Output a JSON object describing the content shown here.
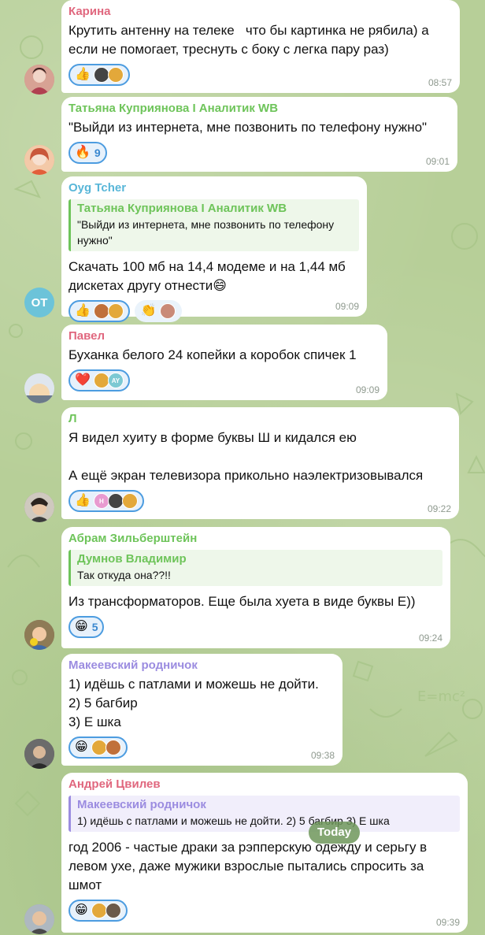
{
  "colors": {
    "accent": "#4c9ce0",
    "karina": "#e0677e",
    "tatiana": "#6ec45a",
    "oyg": "#58b6d8",
    "pavel": "#e0677e",
    "l": "#6ec45a",
    "abram": "#6ec45a",
    "dumnov": "#6ec45a",
    "makeev": "#9b8ce0",
    "andrey": "#e0677e"
  },
  "date_chip": "Today",
  "messages": [
    {
      "sender": "Карина",
      "text": "Крутить антенну на телеке   что бы картинка не рябила) а если не помогает, треснуть с боку с легка пару раз)",
      "time": "08:57",
      "reactions": [
        {
          "emoji": "👍",
          "count": ""
        }
      ]
    },
    {
      "sender": "Татьяна Куприянова I Аналитик WB",
      "text": "\"Выйди из интернета, мне позвонить по телефону нужно\"",
      "time": "09:01",
      "reactions": [
        {
          "emoji": "🔥",
          "count": "9"
        }
      ]
    },
    {
      "sender": "Oyg Tcher",
      "avatar_initials": "OT",
      "quote": {
        "name": "Татьяна Куприянова I Аналитик WB",
        "text": "\"Выйди из интернета, мне позвонить по телефону нужно\""
      },
      "text": "Скачать 100 мб на 14,4 модеме и на 1,44 мб дискетах другу отнести😄",
      "time": "09:09",
      "reactions": [
        {
          "emoji": "👍",
          "count": ""
        },
        {
          "emoji": "👏",
          "count": ""
        }
      ]
    },
    {
      "sender": "Павел",
      "text": "Буханка белого 24 копейки а коробок спичек 1",
      "time": "09:09",
      "reactions": [
        {
          "emoji": "❤️",
          "count": ""
        }
      ],
      "mini_label": "AY"
    },
    {
      "sender": "Л",
      "text": "Я видел хуиту в форме буквы Ш и кидался ею\n\nА ещё экран телевизора прикольно наэлектризовывался",
      "time": "09:22",
      "reactions": [
        {
          "emoji": "👍",
          "count": ""
        }
      ],
      "mini_label": "H"
    },
    {
      "sender": "Абрам Зильберштейн",
      "quote": {
        "name": "Думнов Владимир",
        "text": "Так откуда она??!!"
      },
      "text": "Из трансформаторов. Еще была хуета в виде буквы Е))",
      "time": "09:24",
      "reactions": [
        {
          "emoji": "😁",
          "count": "5"
        }
      ]
    },
    {
      "sender": "Макеевский родничок",
      "text": "1) идёшь с патлами и можешь не дойти.\n2) 5 багбир\n3) Е шка",
      "time": "09:38",
      "reactions": [
        {
          "emoji": "😁",
          "count": ""
        }
      ]
    },
    {
      "sender": "Андрей Цвилев",
      "quote": {
        "name": "Макеевский родничок",
        "text": "1) идёшь с патлами и можешь не дойти. 2) 5 багбир 3) Е шка"
      },
      "text": "год 2006 - частые драки за рэпперскую одежду и серьгу в левом ухе, даже мужики взрослые пытались спросить за шмот",
      "time": "09:39",
      "reactions": [
        {
          "emoji": "😁",
          "count": ""
        }
      ]
    }
  ]
}
